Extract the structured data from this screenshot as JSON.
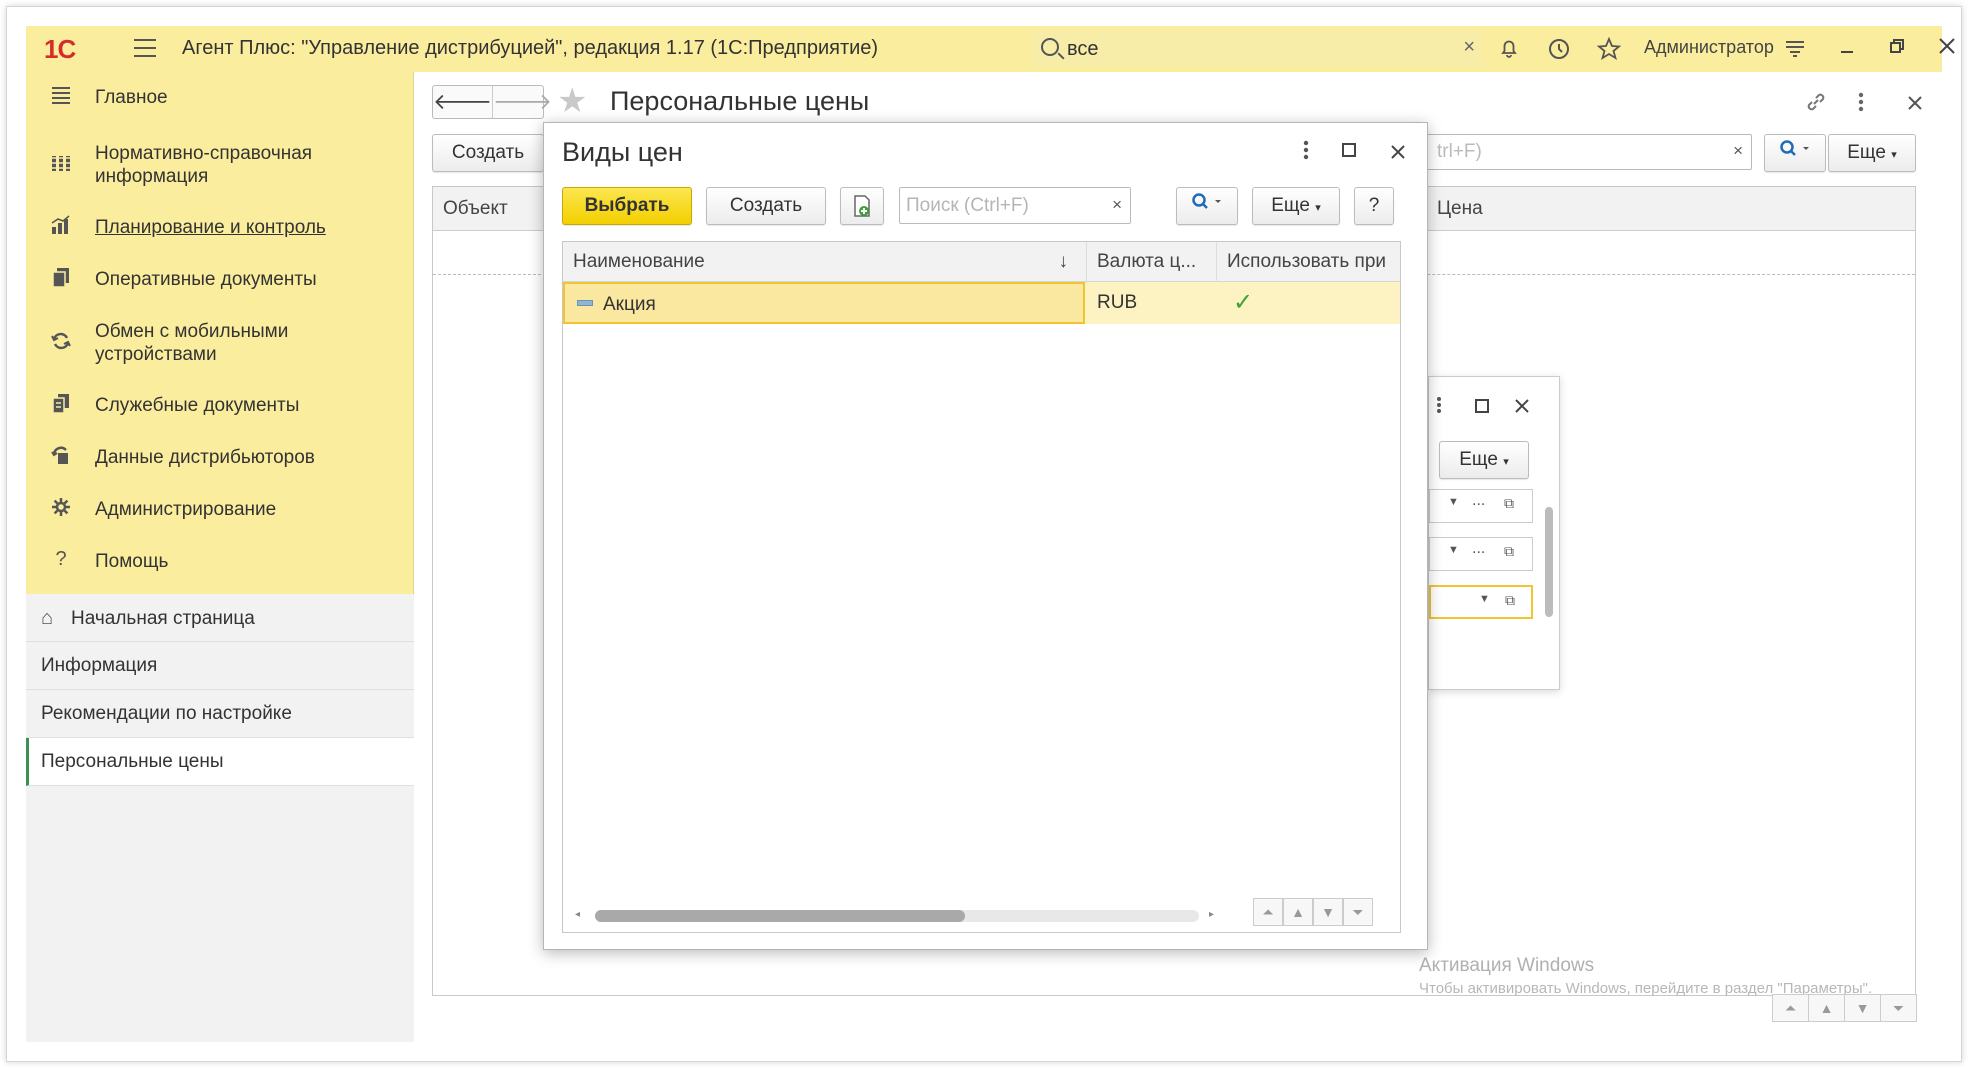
{
  "titlebar": {
    "logo": "1С",
    "title": "Агент Плюс: \"Управление дистрибуцией\", редакция 1.17  (1С:Предприятие)",
    "search_value": "все",
    "search_clear": "×",
    "user": "Администратор"
  },
  "sidebar": {
    "sections": [
      {
        "label": "Главное",
        "icon": "menu-icon"
      },
      {
        "label": "Нормативно-справочная информация",
        "icon": "catalog-icon"
      },
      {
        "label": "Планирование и контроль",
        "icon": "chart-icon"
      },
      {
        "label": "Оперативные документы",
        "icon": "documents-icon"
      },
      {
        "label": "Обмен с мобильными устройствами",
        "icon": "sync-icon"
      },
      {
        "label": "Служебные документы",
        "icon": "service-docs-icon"
      },
      {
        "label": "Данные дистрибьюторов",
        "icon": "distributor-icon"
      },
      {
        "label": "Администрирование",
        "icon": "gear-icon"
      },
      {
        "label": "Помощь",
        "icon": "help-icon"
      }
    ],
    "open_windows": [
      {
        "label": "Начальная страница"
      },
      {
        "label": "Информация"
      },
      {
        "label": "Рекомендации по настройке"
      },
      {
        "label": "Персональные цены"
      }
    ]
  },
  "main": {
    "title": "Персональные цены",
    "create_label": "Создать",
    "search_placeholder": "trl+F)",
    "more_label": "Еще",
    "columns": [
      "Объект",
      "Цена"
    ],
    "watermark_title": "Активация Windows",
    "watermark_text": "Чтобы активировать Windows, перейдите в раздел \"Параметры\"."
  },
  "dialog": {
    "title": "Виды цен",
    "select_label": "Выбрать",
    "create_label": "Создать",
    "search_placeholder": "Поиск (Ctrl+F)",
    "search_clear": "×",
    "more_label": "Еще",
    "help_label": "?",
    "columns": [
      "Наименование",
      "Валюта ц...",
      "Использовать при"
    ],
    "sort_indicator": "↓",
    "rows": [
      {
        "name": "Акция",
        "currency": "RUB",
        "use": true
      }
    ]
  },
  "dialog2": {
    "more_label": "Еще"
  },
  "colors": {
    "accent_yellow": "#fbed9e",
    "primary_button": "#f3cf00",
    "active_marker": "#3d8f52",
    "check": "#3aa335"
  }
}
